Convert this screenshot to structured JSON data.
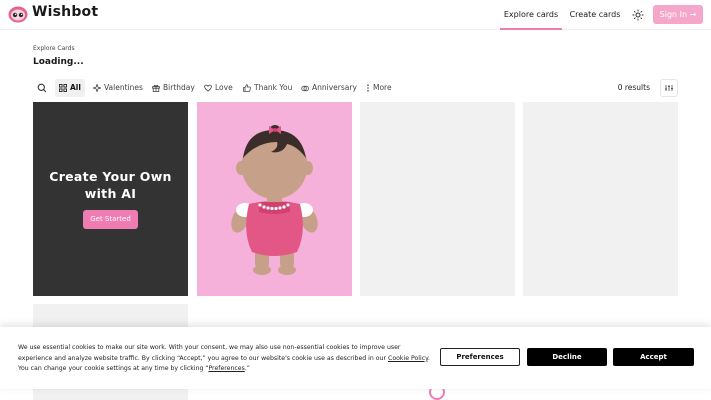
{
  "header": {
    "brand": "Wishbot",
    "nav": {
      "explore": "Explore cards",
      "create": "Create cards"
    },
    "sign_in": "Sign In"
  },
  "breadcrumb": "Explore Cards",
  "page_title": "Loading...",
  "filters": {
    "chips": [
      {
        "label": "All",
        "icon": "grid-icon"
      },
      {
        "label": "Valentines",
        "icon": "sparkle-icon"
      },
      {
        "label": "Birthday",
        "icon": "gift-icon"
      },
      {
        "label": "Love",
        "icon": "heart-icon"
      },
      {
        "label": "Thank You",
        "icon": "thumbs-up-icon"
      },
      {
        "label": "Anniversary",
        "icon": "rings-icon"
      },
      {
        "label": "More",
        "icon": "more-vertical-icon"
      }
    ],
    "results": "0 results"
  },
  "ai_card": {
    "title": "Create Your Own with AI",
    "button": "Get Started"
  },
  "cookie": {
    "text_1": "We use essential cookies to make our site work. With your consent, we may also use non-essential cookies to improve user experience and analyze website traffic. By clicking “Accept,” you agree to our website's cookie use as described in our ",
    "policy_link": "Cookie Policy",
    "text_2": ". You can change your cookie settings at any time by clicking “",
    "pref_link": "Preferences",
    "text_3": ".”",
    "preferences": "Preferences",
    "decline": "Decline",
    "accept": "Accept"
  },
  "colors": {
    "accent": "#f07cb4",
    "sign_in_bg": "#f4a7ca",
    "ai_card_bg": "#333333",
    "baby_card_bg": "#f5b1d9",
    "placeholder_bg": "#f1f1f1"
  }
}
